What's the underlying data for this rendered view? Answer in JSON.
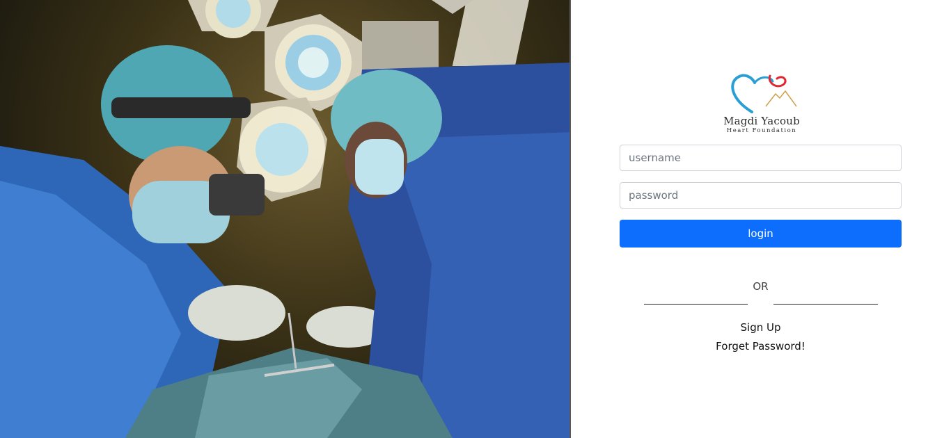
{
  "hero": {
    "image": "surgeons-operating-room-photo"
  },
  "logo": {
    "name": "Magdi Yacoub",
    "subtitle": "Heart Foundation",
    "colors": {
      "heart_blue": "#2a9fd6",
      "ribbon_red": "#e3262f",
      "mountain_gold": "#c9a24a"
    }
  },
  "form": {
    "username_placeholder": "username",
    "password_placeholder": "password",
    "login_label": "login",
    "or_label": "OR",
    "signup_label": "Sign Up",
    "forget_label": "Forget Password!"
  },
  "colors": {
    "primary": "#0d6efd"
  }
}
